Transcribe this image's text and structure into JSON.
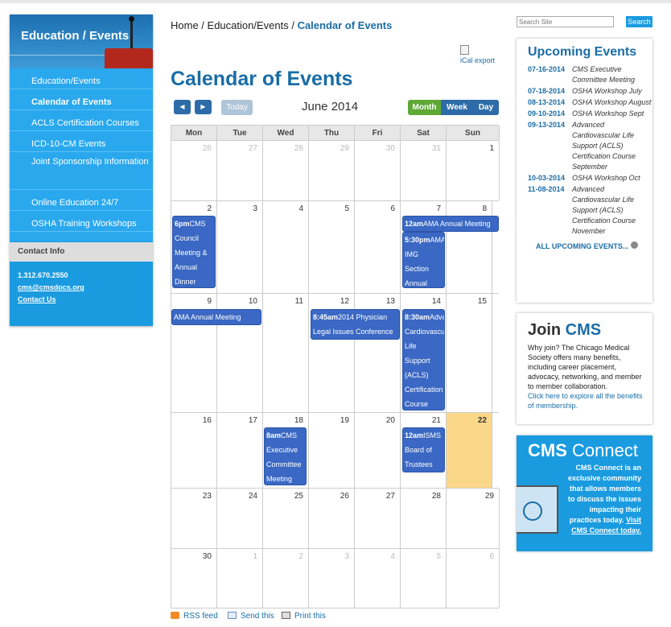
{
  "sidebar": {
    "header": "Education / Events",
    "items": [
      {
        "label": "Education/Events"
      },
      {
        "label": "Calendar of Events"
      },
      {
        "label": "ACLS Certification Courses"
      },
      {
        "label": "ICD-10-CM Events"
      },
      {
        "label": "Joint Sponsorship Information"
      },
      {
        "label": "Online Education 24/7"
      },
      {
        "label": "OSHA Training Workshops"
      }
    ],
    "contact_header": "Contact Info",
    "phone": "1.312.670.2550",
    "email": "cms@cmsdocs.org",
    "contact_link": "Contact Us"
  },
  "breadcrumb": {
    "home": "Home",
    "section": "Education/Events",
    "current": "Calendar of Events",
    "sep": " / "
  },
  "ical": "iCal export",
  "page_title": "Calendar of Events",
  "toolbar": {
    "prev": "◀",
    "next": "▶",
    "today": "Today",
    "month": "June 2014",
    "views": [
      "Month",
      "Week",
      "Day"
    ]
  },
  "calendar": {
    "days": [
      "Mon",
      "Tue",
      "Wed",
      "Thu",
      "Fri",
      "Sat",
      "Sun"
    ],
    "weeks": [
      [
        "26",
        "27",
        "28",
        "29",
        "30",
        "31",
        "1"
      ],
      [
        "2",
        "3",
        "4",
        "5",
        "6",
        "7",
        "8"
      ],
      [
        "9",
        "10",
        "11",
        "12",
        "13",
        "14",
        "15"
      ],
      [
        "16",
        "17",
        "18",
        "19",
        "20",
        "21",
        "22"
      ],
      [
        "23",
        "24",
        "25",
        "26",
        "27",
        "28",
        "29"
      ],
      [
        "30",
        "1",
        "2",
        "3",
        "4",
        "5",
        "6"
      ]
    ],
    "events": {
      "e1": {
        "time": "6pm",
        "title": "CMS Council Meeting & Annual Dinner"
      },
      "e2": {
        "time": "12am",
        "title": "AMA Annual Meeting"
      },
      "e3": {
        "time": "5:30pm",
        "title": "AMA IMG Section Annual Meeting"
      },
      "e4": {
        "title": "AMA Annual Meeting"
      },
      "e5": {
        "time": "8:45am",
        "title": "2014 Physician Legal Issues Conference"
      },
      "e6": {
        "time": "8:30am",
        "title": "Advanced Cardiovascular Life Support (ACLS) Certification Course June"
      },
      "e7": {
        "time": "8am",
        "title": "CMS Executive Committee Meeting"
      },
      "e8": {
        "time": "12am",
        "title": "ISMS Board of Trustees"
      }
    }
  },
  "footer": {
    "rss": "RSS feed",
    "send": "Send this",
    "print": "Print this"
  },
  "search": {
    "placeholder": "Search Site",
    "button": "Search"
  },
  "upcoming": {
    "title": "Upcoming Events",
    "items": [
      {
        "date": "07-16-2014",
        "title": "CMS Executive Committee Meeting"
      },
      {
        "date": "07-18-2014",
        "title": "OSHA Workshop July"
      },
      {
        "date": "08-13-2014",
        "title": "OSHA Workshop August"
      },
      {
        "date": "09-10-2014",
        "title": "OSHA Workshop Sept"
      },
      {
        "date": "09-13-2014",
        "title": "Advanced Cardiovascular Life Support (ACLS) Certification Course September"
      },
      {
        "date": "10-03-2014",
        "title": "OSHA Workshop Oct"
      },
      {
        "date": "11-08-2014",
        "title": "Advanced Cardiovascular Life Support (ACLS) Certification Course November"
      }
    ],
    "all": "ALL UPCOMING EVENTS..."
  },
  "join": {
    "title_a": "Join ",
    "title_b": "CMS",
    "text": "Why join? The Chicago Medical Society offers many benefits, including career placement, advocacy, networking, and member to member collaboration.",
    "link": "Click here to explore all the benefits of membership."
  },
  "connect": {
    "title_a": "CMS ",
    "title_b": "Connect",
    "text": "CMS Connect is an exclusive community that allows members to discuss the issues impacting their practices today.",
    "link": "Visit CMS Connect today."
  }
}
